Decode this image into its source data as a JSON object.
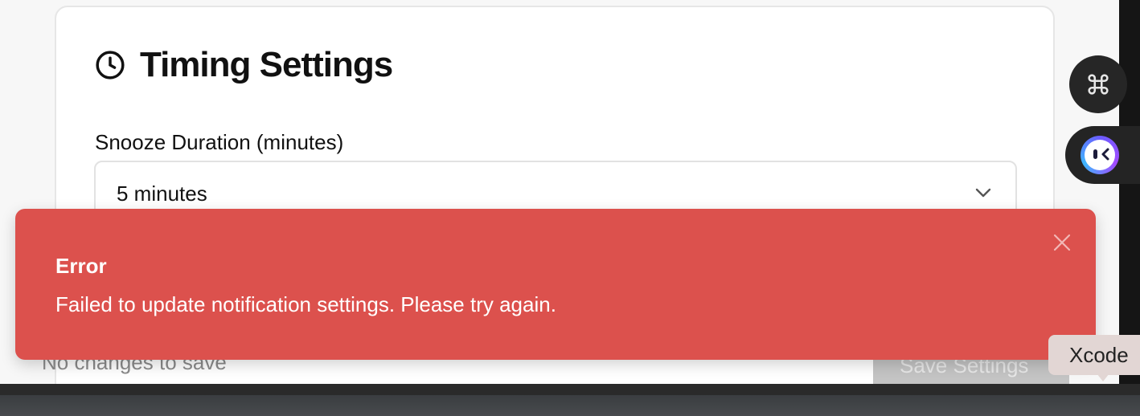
{
  "settings_card": {
    "title": "Timing Settings",
    "title_icon": "clock-icon",
    "snooze": {
      "label": "Snooze Duration (minutes)",
      "selected": "5 minutes"
    }
  },
  "footer": {
    "status": "No changes to save",
    "save_label": "Save Settings"
  },
  "toast": {
    "title": "Error",
    "message": "Failed to update notification settings. Please try again.",
    "background": "#dc514d"
  },
  "dock_tooltip": {
    "label": "Xcode"
  },
  "floating_buttons": [
    {
      "icon": "command-icon"
    },
    {
      "icon": "assistant-icon"
    }
  ]
}
